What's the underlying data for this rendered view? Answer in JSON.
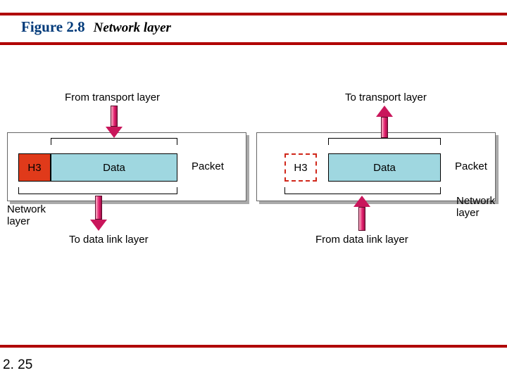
{
  "figure": {
    "label": "Figure 2.8",
    "title": "Network layer"
  },
  "slide_number": "2. 25",
  "left": {
    "in_label": "From transport layer",
    "out_label": "To data link layer",
    "header_seg": "H3",
    "data_seg": "Data",
    "unit_label": "Packet",
    "layer_label": "Network\nlayer"
  },
  "right": {
    "in_label": "From data link layer",
    "out_label": "To transport layer",
    "header_seg": "H3",
    "data_seg": "Data",
    "unit_label": "Packet",
    "layer_label": "Network\nlayer"
  }
}
